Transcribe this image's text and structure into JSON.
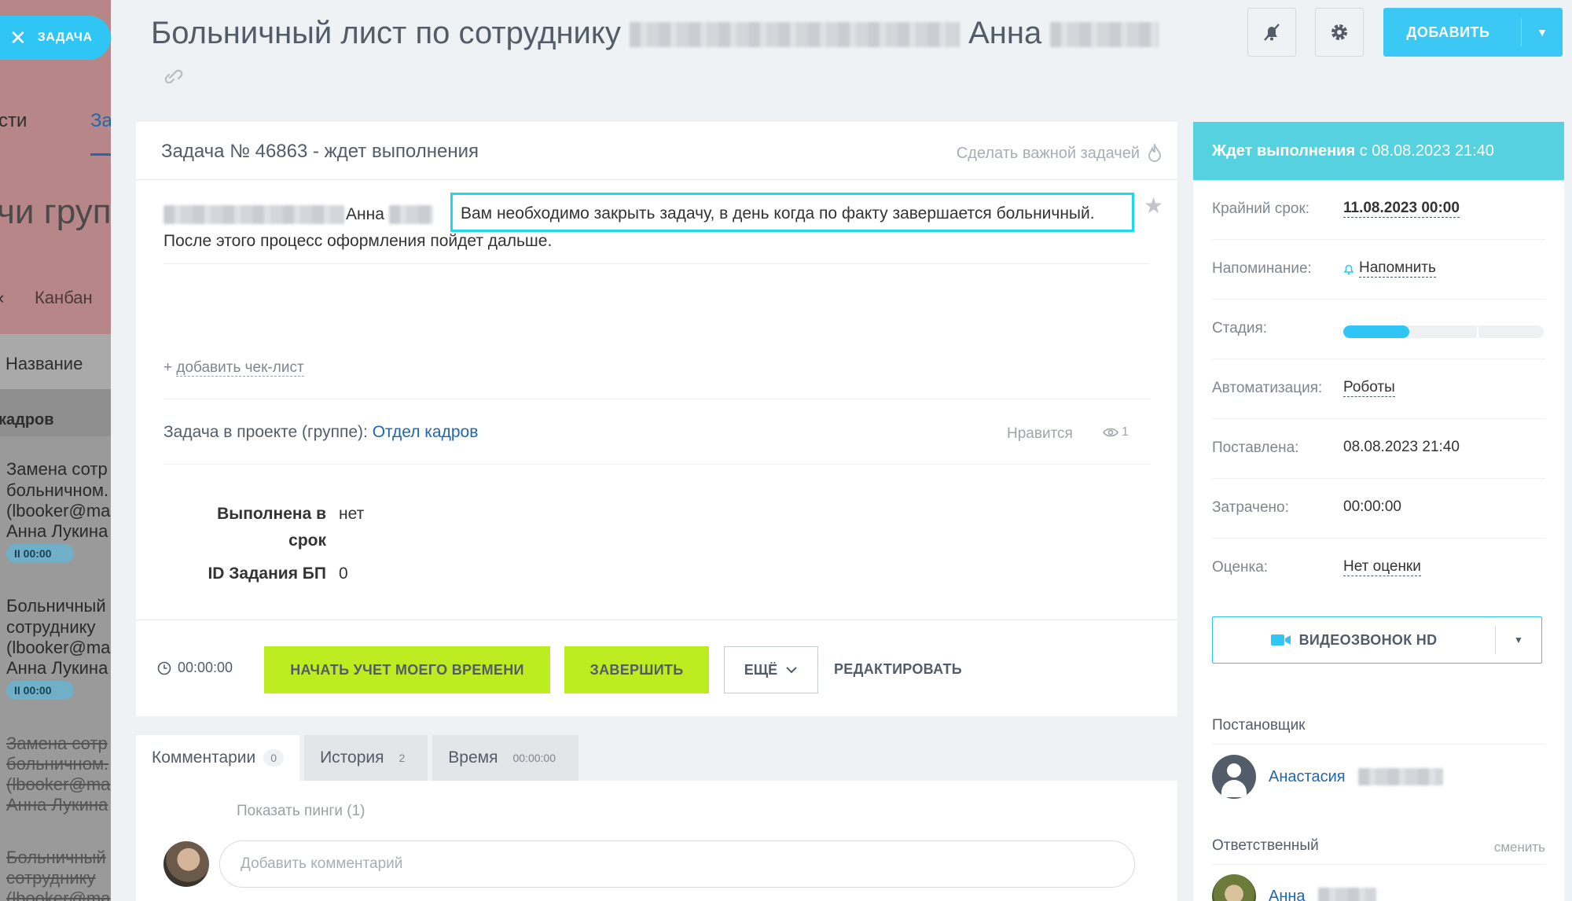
{
  "slider": {
    "close_label": "ЗАДАЧА"
  },
  "background": {
    "tab_partial_1": "сти",
    "tab_partial_2": "За",
    "heading_partial": "чи груп",
    "view_kanban": "Канбан",
    "col_name": "Название",
    "group_partial": "кадров",
    "items": [
      {
        "lines": [
          "Замена сотр",
          "больничном.",
          "(lbooker@ma",
          "Анна Лукина"
        ],
        "time": "00:00"
      },
      {
        "lines": [
          "Больничный",
          "сотруднику",
          "(lbooker@ma",
          "Анна Лукина"
        ],
        "time": "00:00"
      },
      {
        "lines": [
          "Замена сотр",
          "больничном.",
          "(lbooker@ma",
          "Анна Лукина"
        ]
      },
      {
        "lines": [
          "Больничный",
          "сотруднику",
          "(lbooker@ma"
        ]
      }
    ]
  },
  "header": {
    "title_prefix": "Больничный лист по сотруднику",
    "title_name": "Анна",
    "add_label": "ДОБАВИТЬ"
  },
  "task": {
    "number_status": "Задача № 46863 - ждет выполнения",
    "make_important": "Сделать важной задачей",
    "mention_name": "Анна",
    "highlighted_text": "Вам необходимо закрыть задачу, в день когда по факту завершается больничный.",
    "text_line2": "После этого процесс оформления пойдет дальше.",
    "checklist_plus": "+",
    "checklist_label": "добавить чек-лист",
    "project_label": "Задача в проекте (группе):",
    "project_name": "Отдел кадров",
    "likes": "Нравится",
    "views": "1",
    "fields": [
      {
        "label_line1": "Выполнена в",
        "label_line2": "срок",
        "value": "нет"
      },
      {
        "label": "ID Задания БП",
        "value": "0"
      }
    ]
  },
  "actions": {
    "timer": "00:00:00",
    "start_time": "НАЧАТЬ УЧЕТ МОЕГО ВРЕМЕНИ",
    "complete": "ЗАВЕРШИТЬ",
    "more": "ЕЩЁ",
    "edit": "РЕДАКТИРОВАТЬ"
  },
  "tabs": [
    {
      "label": "Комментарии",
      "count": "0"
    },
    {
      "label": "История",
      "count": "2"
    },
    {
      "label": "Время",
      "count": "00:00:00"
    }
  ],
  "comments": {
    "show_pings": "Показать пинги (1)",
    "placeholder": "Добавить комментарий"
  },
  "sidebar": {
    "status_bold": "Ждет выполнения",
    "status_rest": "с 08.08.2023 21:40",
    "rows": [
      {
        "key": "Крайний срок:",
        "value": "11.08.2023 00:00"
      },
      {
        "key": "Напоминание:",
        "value": "Напомнить"
      },
      {
        "key": "Стадия:",
        "value": ""
      },
      {
        "key": "Автоматизация:",
        "value": "Роботы"
      },
      {
        "key": "Поставлена:",
        "value": "08.08.2023 21:40"
      },
      {
        "key": "Затрачено:",
        "value": "00:00:00"
      },
      {
        "key": "Оценка:",
        "value": "Нет оценки"
      }
    ],
    "stage_progress": 0.33,
    "video_call": "ВИДЕОЗВОНОК HD",
    "creator_label": "Постановщик",
    "creator_name": "Анастасия",
    "responsible_label": "Ответственный",
    "change_label": "сменить",
    "responsible_name": "Анна"
  },
  "colors": {
    "accent": "#2fc6f6",
    "status_bar": "#56d1e0",
    "green_button": "#bbed21",
    "highlight_box": "#1fd8e8",
    "link": "#2067b0"
  }
}
